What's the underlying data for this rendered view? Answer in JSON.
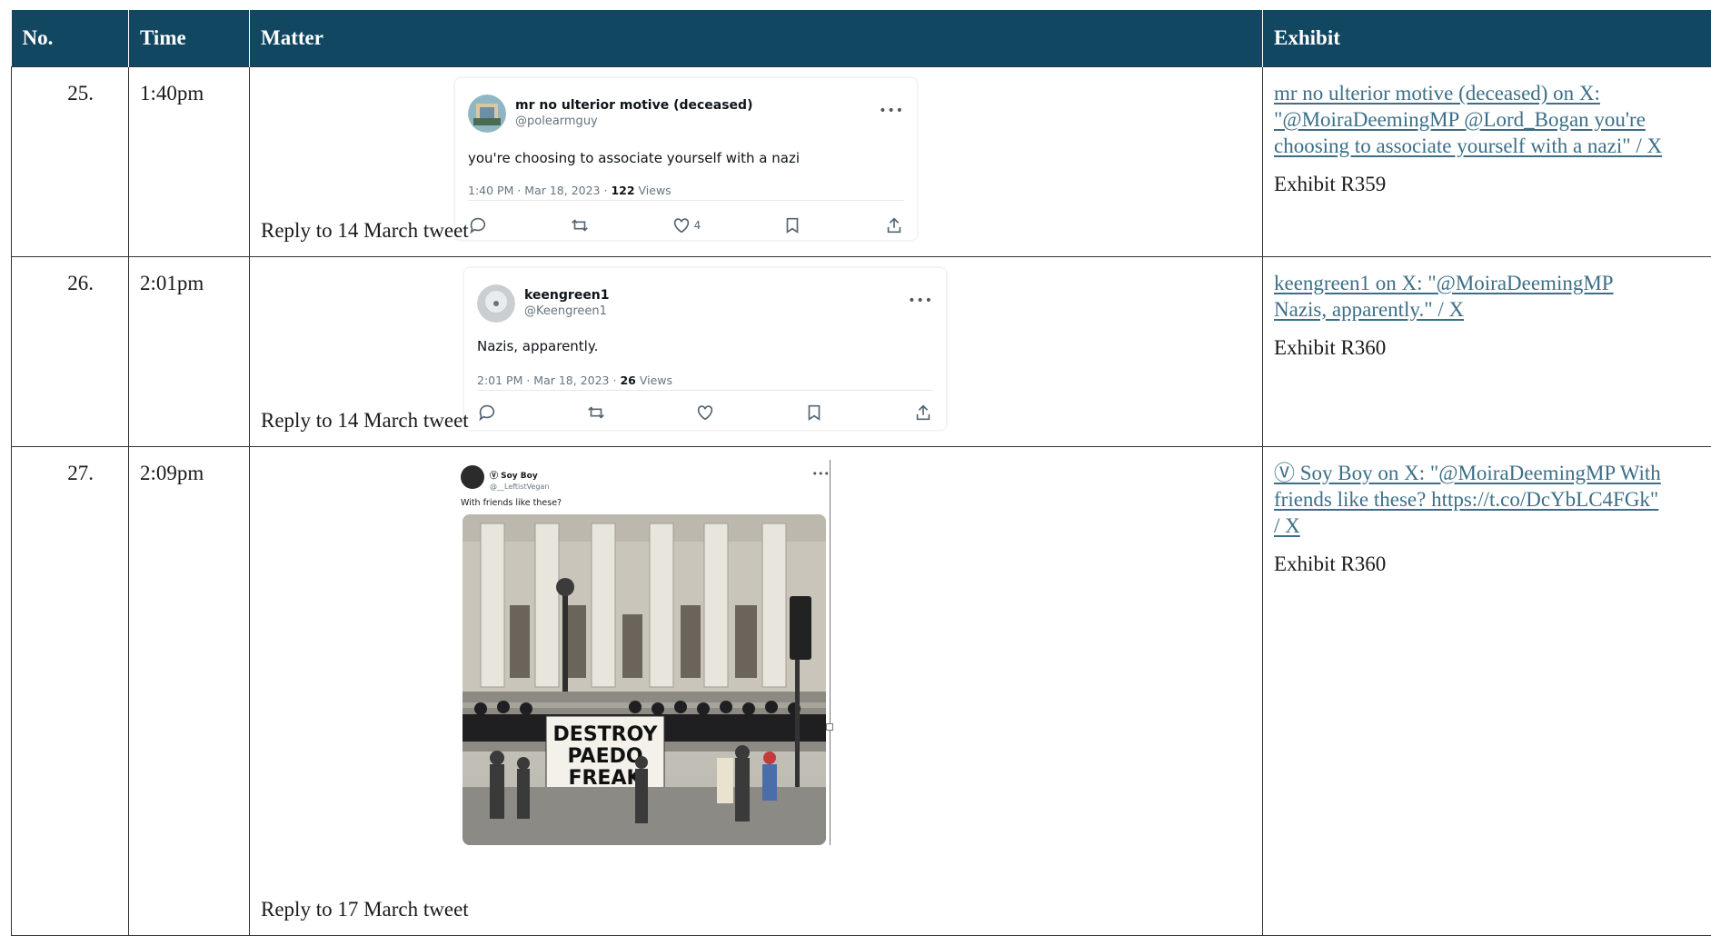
{
  "table": {
    "headers": {
      "no": "No.",
      "time": "Time",
      "matter": "Matter",
      "exhibit": "Exhibit"
    },
    "rows": [
      {
        "no": "25.",
        "time": "1:40pm",
        "matter_label": "Reply to 14 March tweet",
        "tweet": {
          "name": "mr no ulterior motive (deceased)",
          "handle": "@polearmguy",
          "text": "you're choosing to associate yourself with a nazi",
          "meta_prefix": "1:40 PM · Mar 18, 2023 · ",
          "views_count": "122",
          "views_label": " Views",
          "likes": "4"
        },
        "exhibit_link_lines": [
          "mr no ulterior motive (deceased) on X:",
          "\"@MoiraDeemingMP @Lord_Bogan you're",
          "choosing to associate yourself with a nazi\" / X"
        ],
        "exhibit_ref": "Exhibit R359"
      },
      {
        "no": "26.",
        "time": "2:01pm",
        "matter_label": "Reply to 14 March tweet",
        "tweet": {
          "name": "keengreen1",
          "handle": "@Keengreen1",
          "text": "Nazis, apparently.",
          "meta_prefix": "2:01 PM · Mar 18, 2023 · ",
          "views_count": "26",
          "views_label": " Views",
          "likes": ""
        },
        "exhibit_link_lines": [
          "keengreen1 on X: \"@MoiraDeemingMP",
          "Nazis, apparently.\" / X"
        ],
        "exhibit_ref": "Exhibit R360"
      },
      {
        "no": "27.",
        "time": "2:09pm",
        "matter_label": "Reply to 17 March tweet",
        "tweet": {
          "name": "Ⓥ Soy Boy",
          "handle": "@__LeftistVegan",
          "text": "With friends like these?",
          "banner_text": [
            "DESTROY",
            "PAEDO",
            "FREAK"
          ]
        },
        "exhibit_link_lines": [
          "Ⓥ Soy Boy on X: \"@MoiraDeemingMP With",
          "friends like these? https://t.co/DcYbLC4FGk\"",
          "/ X"
        ],
        "exhibit_ref": "Exhibit R360"
      }
    ]
  }
}
